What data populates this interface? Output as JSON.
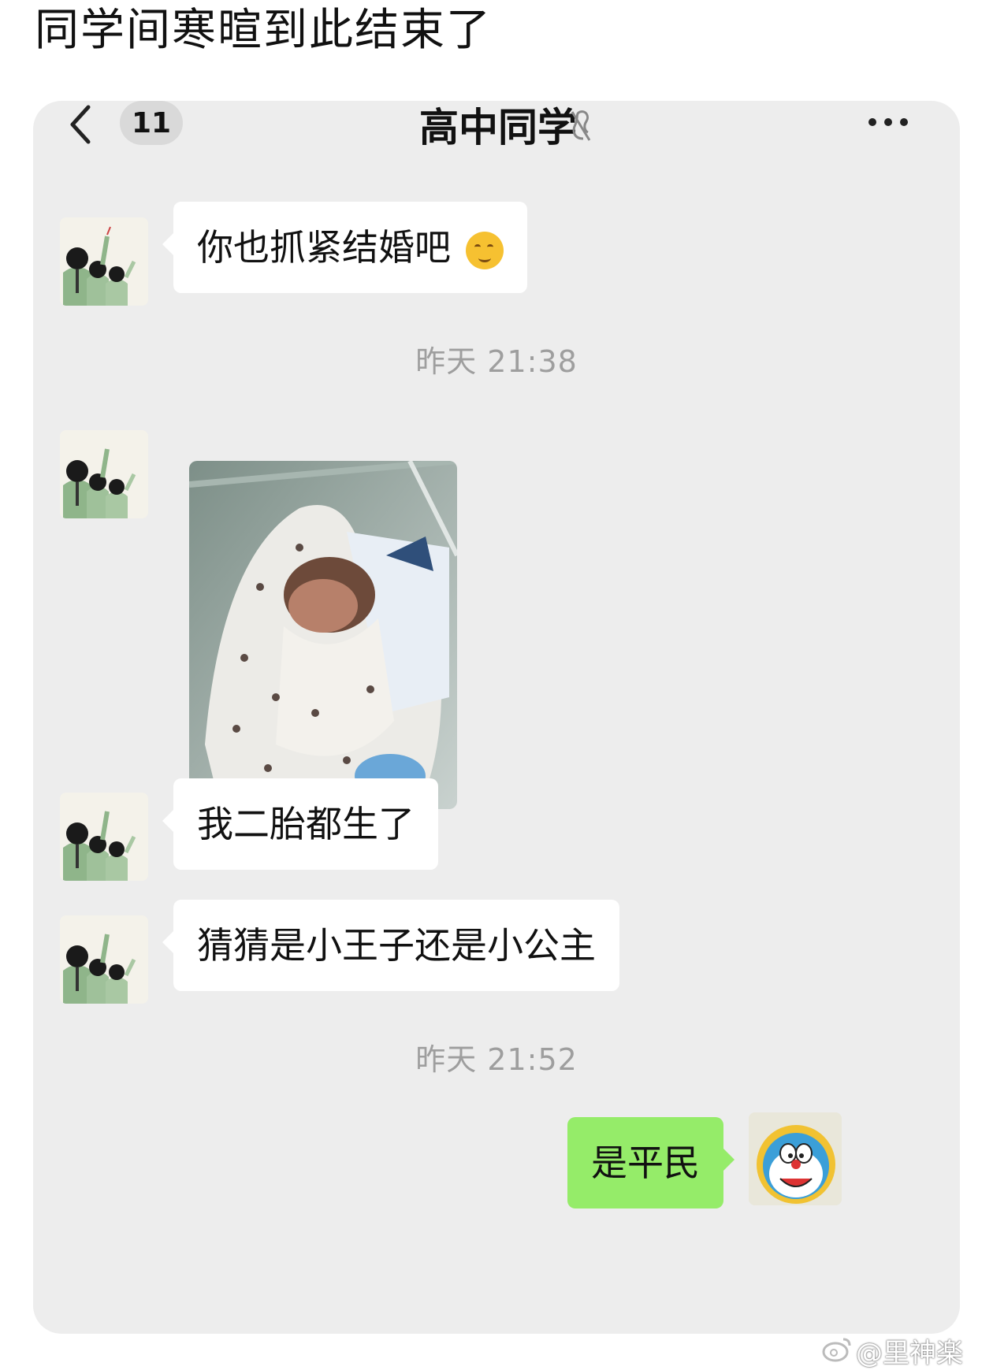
{
  "post": {
    "title": "同学间寒暄到此结束了"
  },
  "nav": {
    "unread_count": "11",
    "chat_title": "高中同学"
  },
  "messages": {
    "m1": "你也抓紧结婚吧",
    "ts1": "昨天 21:38",
    "m2": "我二胎都生了",
    "m3": "猜猜是小王子还是小公主",
    "ts2": "昨天 21:52",
    "m4": "是平民"
  },
  "watermark": {
    "text": "@里神楽"
  },
  "icons": [
    "back-arrow-icon",
    "mute-icon",
    "more-icon",
    "grin-emoji-icon",
    "weibo-icon"
  ],
  "colors": {
    "chat_bg": "#ededed",
    "my_bubble": "#95ec69",
    "their_bubble": "#ffffff",
    "timestamp": "#9e9e9e"
  }
}
